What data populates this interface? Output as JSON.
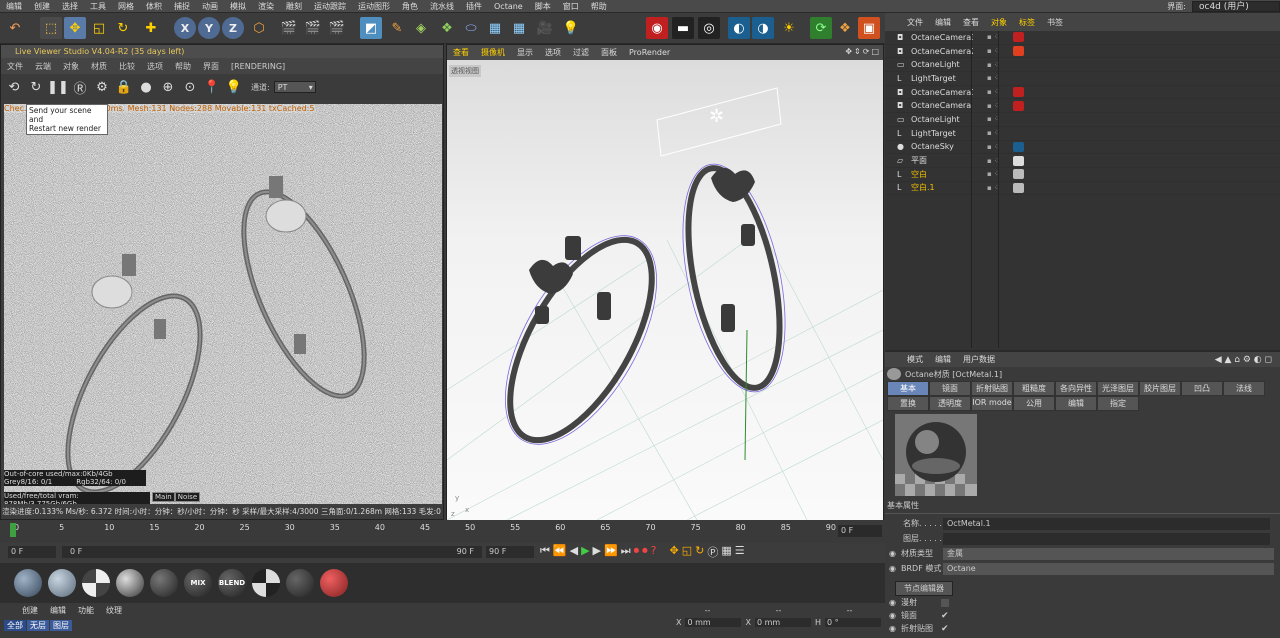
{
  "menubar": {
    "items": [
      {
        "label": "编辑",
        "hl": false
      },
      {
        "label": "创建",
        "hl": false
      },
      {
        "label": "选择",
        "hl": false
      },
      {
        "label": "工具",
        "hl": false
      },
      {
        "label": "网格",
        "hl": false
      },
      {
        "label": "体积",
        "hl": false
      },
      {
        "label": "捕捉",
        "hl": false
      },
      {
        "label": "动画",
        "hl": false
      },
      {
        "label": "模拟",
        "hl": false
      },
      {
        "label": "渲染",
        "hl": false
      },
      {
        "label": "雕刻",
        "hl": false
      },
      {
        "label": "运动跟踪",
        "hl": false
      },
      {
        "label": "运动图形",
        "hl": false
      },
      {
        "label": "角色",
        "hl": false
      },
      {
        "label": "流水线",
        "hl": false
      },
      {
        "label": "插件",
        "hl": false
      },
      {
        "label": "Octane",
        "hl": false
      },
      {
        "label": "脚本",
        "hl": false
      },
      {
        "label": "窗口",
        "hl": false
      },
      {
        "label": "帮助",
        "hl": false
      }
    ],
    "layout_label": "界面:",
    "layout_value": "oc4d (用户)"
  },
  "live_viewer": {
    "title": "Live Viewer Studio V4.04-R2 (35 days left)",
    "menu": [
      "文件",
      "云端",
      "对象",
      "材质",
      "比较",
      "选项",
      "帮助",
      "界面",
      "[RENDERING]"
    ],
    "channel_label": "通道:",
    "channel_value": "PT",
    "status_line": "Chec... 00ms. Update[G]:0ms. Mesh:131 Nodes:288 Movable:131 txCached:5",
    "tooltip_line1": "Send your scene and",
    "tooltip_line2": "Restart new render",
    "ooc": "Out-of-core used/max:0Kb/4Gb",
    "grey": "Grey8/16: 0/1",
    "rgb": "Rgb32/64: 0/0",
    "vram": "Used/free/total vram: 878Mb/3.775Gb/6Gb",
    "tab_main": "Main",
    "tab_noise": "Noise",
    "progress_line": "渲染进度:0.133%      Ms/秒: 6.372  时间:小时：分钟：秒/小时：分钟：秒    采样/最大采样:4/3000  三角面:0/1.268m   网格:133    毛发:0"
  },
  "viewport": {
    "menu": [
      "查看",
      "摄像机",
      "显示",
      "选项",
      "过滤",
      "面板",
      "ProRender"
    ],
    "corner_label": "透视视图"
  },
  "object_manager": {
    "menu": [
      "文件",
      "编辑",
      "查看",
      "对象",
      "标签",
      "书签"
    ],
    "objects": [
      {
        "name": "OctaneCamera3",
        "icon": "camera-icon",
        "tag": "cam"
      },
      {
        "name": "OctaneCamera2",
        "icon": "camera-icon",
        "tag": "cam2"
      },
      {
        "name": "OctaneLight",
        "icon": "light-icon",
        "tag": "light"
      },
      {
        "name": "LightTarget",
        "icon": "target-icon",
        "tag": ""
      },
      {
        "name": "OctaneCamera1",
        "icon": "camera-icon",
        "tag": "cam"
      },
      {
        "name": "OctaneCamera",
        "icon": "camera-icon",
        "tag": "cam"
      },
      {
        "name": "OctaneLight",
        "icon": "light-icon",
        "tag": "light"
      },
      {
        "name": "LightTarget",
        "icon": "target-icon",
        "tag": ""
      },
      {
        "name": "OctaneSky",
        "icon": "sky-icon",
        "tag": "sky"
      },
      {
        "name": "平面",
        "icon": "plane-icon",
        "tag": "mat"
      },
      {
        "name": "空白",
        "icon": "null-icon",
        "tag": "mats"
      },
      {
        "name": "空白.1",
        "icon": "null-icon",
        "tag": "mats"
      }
    ]
  },
  "attributes": {
    "menu": [
      "模式",
      "编辑",
      "用户数据"
    ],
    "header": "Octane材质 [OctMetal.1]",
    "tabs_row1": [
      "基本",
      "镜面",
      "折射贴图",
      "粗糙度",
      "各向异性",
      "光泽图层",
      "胶片图层",
      "凹凸",
      "法线"
    ],
    "tabs_row2": [
      "置换",
      "透明度",
      "IOR mode",
      "公用",
      "编辑",
      "指定"
    ],
    "section": "基本属性",
    "name_label": "名称. . . . .",
    "name_value": "OctMetal.1",
    "layer_label": "图层. . . . .",
    "mat_type_label": "材质类型",
    "mat_type_value": "金属",
    "brdf_label": "BRDF 模式",
    "brdf_value": "Octane",
    "node_editor": "节点编辑器",
    "cb1": "漫射",
    "cb2": "镜面",
    "cb3": "折射贴图"
  },
  "timeline": {
    "ticks": [
      "0",
      "5",
      "10",
      "15",
      "20",
      "25",
      "30",
      "35",
      "40",
      "45",
      "50",
      "55",
      "60",
      "65",
      "70",
      "75",
      "80",
      "85",
      "90"
    ],
    "end_field": "0 F",
    "start": "0 F",
    "range_start": "0 F",
    "range_end": "90 F",
    "end": "90 F"
  },
  "materials": {
    "swatches": [
      "",
      "",
      "",
      "",
      "",
      "MIX",
      "BLEND",
      "",
      "",
      ""
    ]
  },
  "material_manager": {
    "menu": [
      "创建",
      "编辑",
      "功能",
      "纹理"
    ],
    "filters": [
      "全部",
      "无层",
      "图层"
    ]
  },
  "coords": {
    "x_label": "X",
    "x_value": "0 mm",
    "x2_label": "X",
    "x2_value": "0 mm",
    "h_label": "H",
    "h_value": "0 °",
    "dash1": "--",
    "dash2": "--",
    "dash3": "--"
  }
}
